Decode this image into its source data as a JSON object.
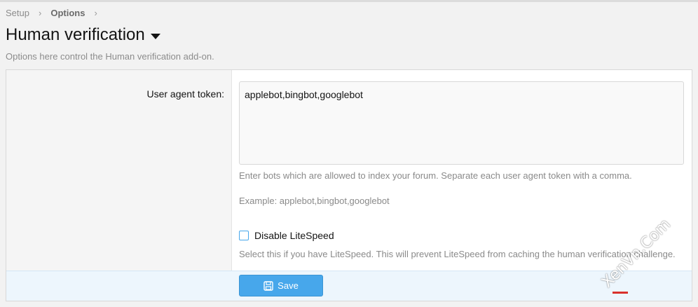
{
  "breadcrumb": {
    "items": [
      "Setup",
      "Options"
    ],
    "separator": "›"
  },
  "page": {
    "title": "Human verification",
    "description": "Options here control the Human verification add-on."
  },
  "options": {
    "user_agent_label": "User agent token:",
    "user_agent_value": "applebot,bingbot,googlebot",
    "user_agent_hint": "Enter bots which are allowed to index your forum. Separate each user agent token with a comma.",
    "user_agent_example": "Example: applebot,bingbot,googlebot",
    "litespeed_label": "Disable LiteSpeed",
    "litespeed_checked": false,
    "litespeed_hint": "Select this if you have LiteSpeed. This will prevent LiteSpeed from caching the human verification challenge."
  },
  "footer": {
    "save_label": "Save"
  },
  "watermark": {
    "text": "XenVn.Com"
  },
  "colors": {
    "accent": "#47a7eb",
    "footer_bg": "#edf6fd"
  }
}
